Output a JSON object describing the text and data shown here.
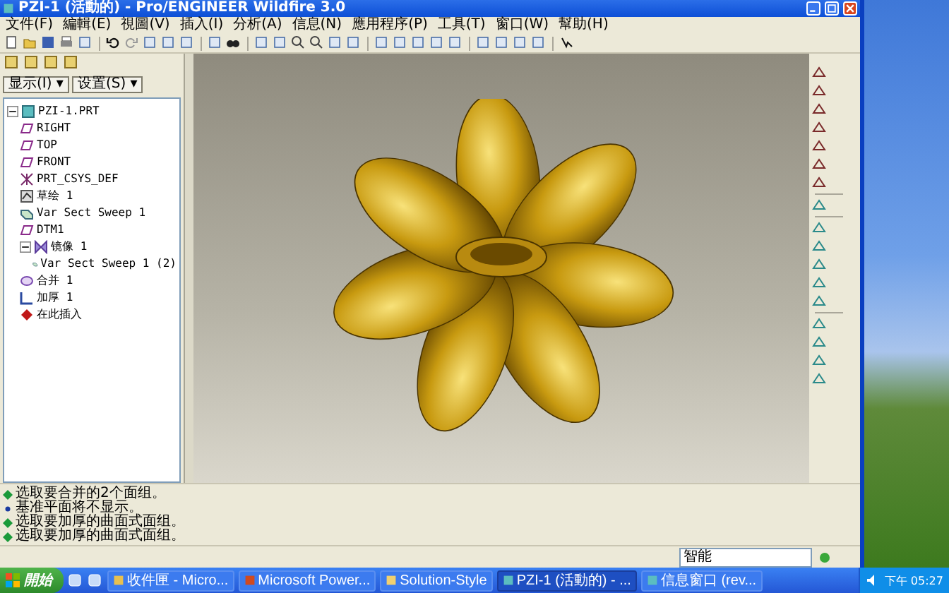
{
  "window": {
    "title": "PZI-1 (活動的) - Pro/ENGINEER Wildfire 3.0"
  },
  "menu": [
    "文件(F)",
    "編輯(E)",
    "視圖(V)",
    "插入(I)",
    "分析(A)",
    "信息(N)",
    "應用程序(P)",
    "工具(T)",
    "窗口(W)",
    "幫助(H)"
  ],
  "panel": {
    "buttons": [
      "显示(I) ▾",
      "设置(S) ▾"
    ],
    "tree": [
      {
        "label": "PZI-1.PRT",
        "kind": "part",
        "expanded": true,
        "children": [
          {
            "label": "RIGHT",
            "kind": "plane"
          },
          {
            "label": "TOP",
            "kind": "plane"
          },
          {
            "label": "FRONT",
            "kind": "plane"
          },
          {
            "label": "PRT_CSYS_DEF",
            "kind": "csys"
          },
          {
            "label": "草绘 1",
            "kind": "sketch"
          },
          {
            "label": "Var Sect Sweep 1",
            "kind": "sweep"
          },
          {
            "label": "DTM1",
            "kind": "plane"
          },
          {
            "label": "镜像 1",
            "kind": "mirror",
            "expanded": true,
            "children": [
              {
                "label": "Var Sect Sweep 1 (2)",
                "kind": "sweep"
              }
            ]
          },
          {
            "label": "合并 1",
            "kind": "merge"
          },
          {
            "label": "加厚 1",
            "kind": "thicken"
          },
          {
            "label": "在此插入",
            "kind": "insert"
          }
        ]
      }
    ]
  },
  "messages": [
    {
      "text": "选取要合并的2个面组。",
      "kind": "prompt"
    },
    {
      "text": "基准平面将不显示。",
      "kind": "info"
    },
    {
      "text": "选取要加厚的曲面式面组。",
      "kind": "prompt"
    },
    {
      "text": "选取要加厚的曲面式面组。",
      "kind": "prompt"
    }
  ],
  "status_bar": {
    "filter": "智能"
  },
  "taskbar": {
    "start": "開始",
    "tasks": [
      {
        "label": "收件匣 - Micro...",
        "kind": "mail",
        "selected": false
      },
      {
        "label": "Microsoft Power...",
        "kind": "ppt",
        "selected": false
      },
      {
        "label": "Solution-Style",
        "kind": "folder",
        "selected": false
      },
      {
        "label": "PZI-1 (活動的) - ...",
        "kind": "app",
        "selected": true
      },
      {
        "label": "信息窗口 (rev...",
        "kind": "app",
        "selected": false
      }
    ],
    "clock": "下午 05:27"
  }
}
